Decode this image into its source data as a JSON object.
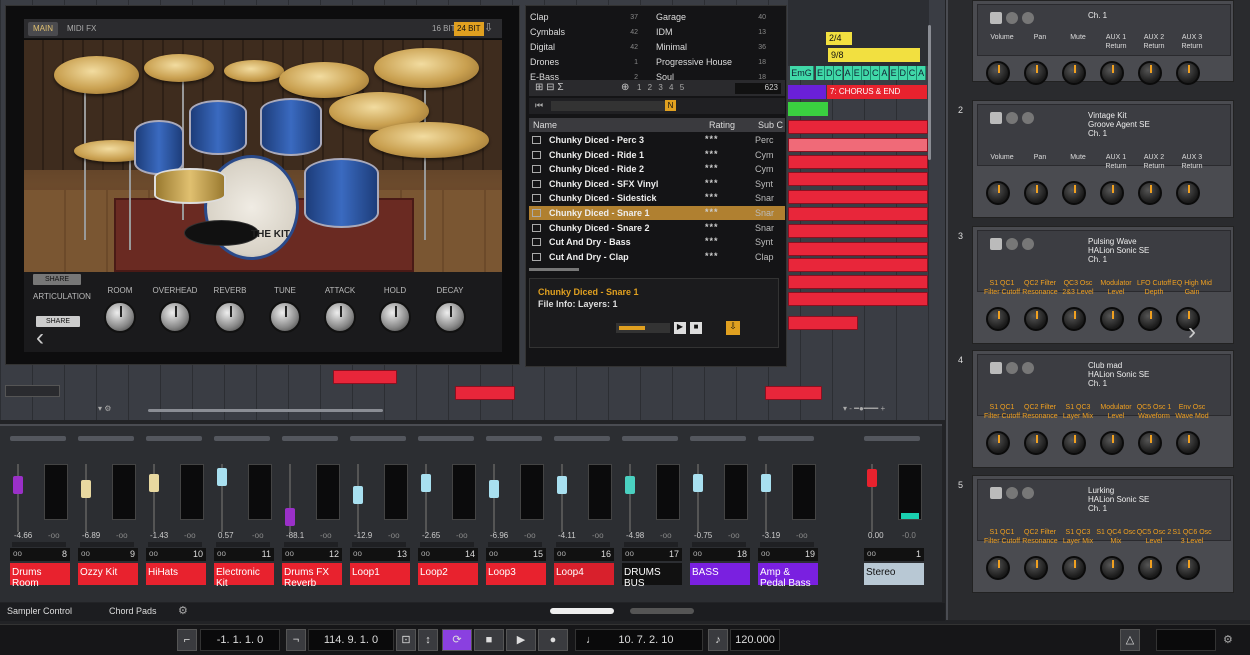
{
  "instrument": {
    "tabs": [
      "MAIN",
      "MIDI FX"
    ],
    "bits": [
      "16 BIT",
      "24 BIT"
    ],
    "kit_label": "THE KIT",
    "share_top": "SHARE",
    "share_bottom": "SHARE",
    "articulation": "ARTICULATION",
    "knobs": [
      "ROOM",
      "OVERHEAD",
      "REVERB",
      "TUNE",
      "ATTACK",
      "HOLD",
      "DECAY"
    ]
  },
  "browser": {
    "categories_left": [
      {
        "label": "Clap",
        "count": "37"
      },
      {
        "label": "Cymbals",
        "count": "42"
      },
      {
        "label": "Digital",
        "count": "42"
      },
      {
        "label": "Drones",
        "count": "1"
      },
      {
        "label": "E-Bass",
        "count": "2"
      }
    ],
    "categories_right": [
      {
        "label": "Garage",
        "count": "40"
      },
      {
        "label": "IDM",
        "count": "13"
      },
      {
        "label": "Minimal",
        "count": "36"
      },
      {
        "label": "Progressive House",
        "count": "18"
      },
      {
        "label": "Soul",
        "count": "18"
      }
    ],
    "pages": "1 2 3 4 5",
    "result_count": "623",
    "n_badge": "N",
    "columns": [
      "Name",
      "Rating",
      "Sub C"
    ],
    "results": [
      {
        "name": "Chunky Diced - Perc 3",
        "rating": "***",
        "sub": "Perc"
      },
      {
        "name": "Chunky Diced - Ride 1",
        "rating": "***",
        "sub": "Cym"
      },
      {
        "name": "Chunky Diced - Ride 2",
        "rating": "***",
        "sub": "Cym"
      },
      {
        "name": "Chunky Diced - SFX Vinyl",
        "rating": "***",
        "sub": "Synt"
      },
      {
        "name": "Chunky Diced - Sidestick",
        "rating": "***",
        "sub": "Snar"
      },
      {
        "name": "Chunky Diced - Snare 1",
        "rating": "***",
        "sub": "Snar"
      },
      {
        "name": "Chunky Diced - Snare 2",
        "rating": "***",
        "sub": "Snar"
      },
      {
        "name": "Cut And Dry - Bass",
        "rating": "***",
        "sub": "Synt"
      },
      {
        "name": "Cut And Dry - Clap",
        "rating": "***",
        "sub": "Clap"
      }
    ],
    "selected_title": "Chunky Diced - Snare 1",
    "file_info": "File Info: Layers:  1"
  },
  "arrange": {
    "sig1": "2/4",
    "sig2": "9/8",
    "chords": [
      "EmG",
      "E",
      "D",
      "C",
      "A",
      "E",
      "D",
      "C",
      "A",
      "E",
      "D",
      "C",
      "A"
    ],
    "marker": "7: CHORUS & END"
  },
  "mixer": {
    "channels": [
      {
        "num": "8",
        "name": "Drums Room",
        "db": "-4.66",
        "pk": "-oo",
        "color": "#e8222e",
        "fader": "#9a30c8"
      },
      {
        "num": "9",
        "name": "Ozzy Kit",
        "db": "-6.89",
        "pk": "-oo",
        "color": "#e8222e",
        "fader": "#e8d8a0"
      },
      {
        "num": "10",
        "name": "HiHats",
        "db": "-1.43",
        "pk": "-oo",
        "color": "#e8222e",
        "fader": "#e8d8a0"
      },
      {
        "num": "11",
        "name": "Electronic Kit",
        "db": "0.57",
        "pk": "-oo",
        "color": "#e8222e",
        "fader": "#a8e0f0"
      },
      {
        "num": "12",
        "name": "Drums FX Reverb",
        "db": "-88.1",
        "pk": "-oo",
        "color": "#e8222e",
        "fader": "#9a30c8"
      },
      {
        "num": "13",
        "name": "Loop1",
        "db": "-12.9",
        "pk": "-oo",
        "color": "#e8222e",
        "fader": "#a8e0f0"
      },
      {
        "num": "14",
        "name": "Loop2",
        "db": "-2.65",
        "pk": "-oo",
        "color": "#e8222e",
        "fader": "#a8e0f0"
      },
      {
        "num": "15",
        "name": "Loop3",
        "db": "-6.96",
        "pk": "-oo",
        "color": "#e8222e",
        "fader": "#a8e0f0"
      },
      {
        "num": "16",
        "name": "Loop4",
        "db": "-4.11",
        "pk": "-oo",
        "color": "#d8202c",
        "fader": "#a8e0f0"
      },
      {
        "num": "17",
        "name": "DRUMS BUS",
        "db": "-4.98",
        "pk": "-oo",
        "color": "#111111",
        "fader": "#4ad0c0"
      },
      {
        "num": "18",
        "name": "BASS",
        "db": "-0.75",
        "pk": "-oo",
        "color": "#7a20e0",
        "fader": "#a8e0f0"
      },
      {
        "num": "19",
        "name": "Amp & Pedal Bass",
        "db": "-3.19",
        "pk": "-oo",
        "color": "#7a20e0",
        "fader": "#a8e0f0"
      }
    ],
    "stereo": {
      "num": "1",
      "name": "Stereo",
      "db": "0.00",
      "pk": "-0.0"
    }
  },
  "bottom_tabs": [
    "Sampler Control",
    "Chord Pads"
  ],
  "transport": {
    "left_locator": "-1. 1. 1.   0",
    "right_locator": "114. 9. 1.   0",
    "position": "10. 7. 2.   10",
    "tempo": "120.000"
  },
  "rack": [
    {
      "slot": "",
      "title": "",
      "line2": "Ch. 1",
      "labels": [
        "Volume",
        "Pan",
        "Mute",
        "AUX 1 Return",
        "AUX 2 Return",
        "AUX 3 Return"
      ],
      "orange": false
    },
    {
      "slot": "2",
      "title": "Vintage Kit",
      "line2": "Groove Agent SE",
      "line3": "Ch. 1",
      "labels": [
        "Volume",
        "Pan",
        "Mute",
        "AUX 1 Return",
        "AUX 2 Return",
        "AUX 3 Return"
      ],
      "orange": false
    },
    {
      "slot": "3",
      "title": "Pulsing Wave",
      "line2": "HALion Sonic SE",
      "line3": "Ch. 1",
      "labels": [
        "S1 QC1 Filter Cutoff",
        "QC2 Filter Resonance",
        "QC3 Osc 2&3 Level",
        "Modulator Level",
        "LFO Cutoff Depth",
        "EQ High Mid Gain"
      ],
      "orange": true
    },
    {
      "slot": "4",
      "title": "Club mad",
      "line2": "HALion Sonic SE",
      "line3": "Ch. 1",
      "labels": [
        "S1 QC1 Filter Cutoff",
        "QC2 Filter Resonance",
        "S1 QC3 Layer Mix",
        "Modulator Level",
        "QC5 Osc 1 Waveform",
        "Env Osc Wave Mod"
      ],
      "orange": true
    },
    {
      "slot": "5",
      "title": "Lurking",
      "line2": "HALion Sonic SE",
      "line3": "Ch. 1",
      "labels": [
        "S1 QC1 Filter Cutoff",
        "QC2 Filter Resonance",
        "S1 QC3 Layer Mix",
        "S1 QC4 Osc Mix",
        "QC5 Osc 2 Level",
        "S1 QC6 Osc 3 Level"
      ],
      "orange": true
    }
  ]
}
